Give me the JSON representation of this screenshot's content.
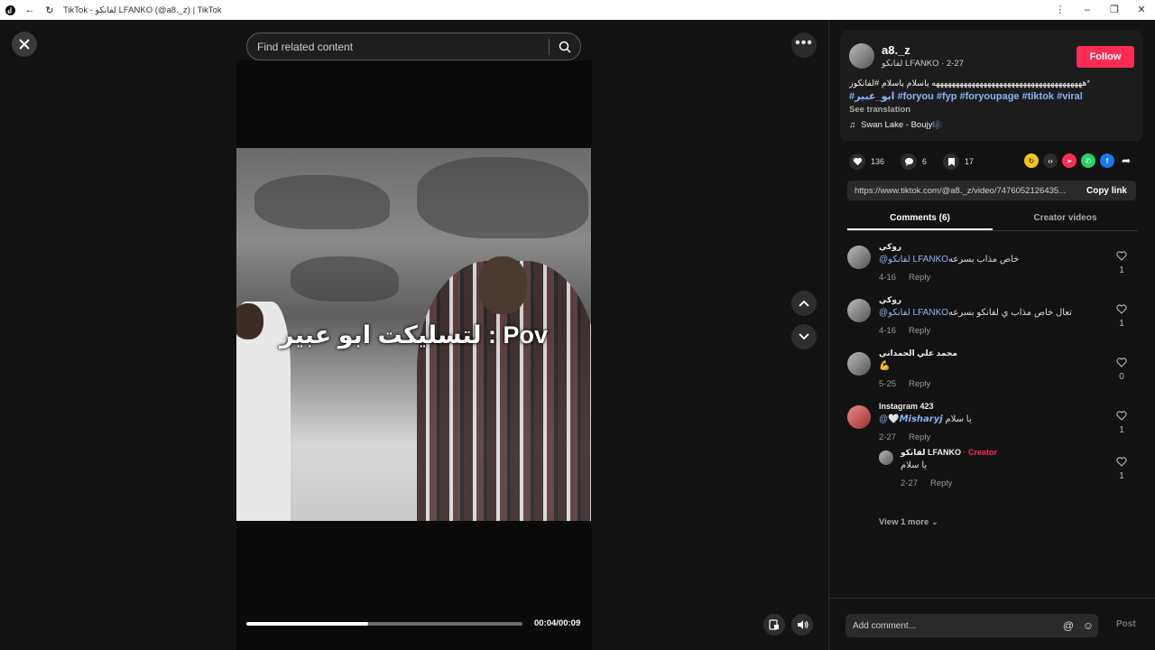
{
  "window": {
    "title": "TikTok - لفانكو LFANKO (@a8._z) | TikTok",
    "controls": [
      "⋮",
      "–",
      "❐",
      "✕"
    ]
  },
  "player": {
    "search_placeholder": "Find related content",
    "caption": "لتسليكت ابو عبير : Pov",
    "progress": 0.44,
    "timecode": "00:04/00:09"
  },
  "video_info": {
    "username": "a8._z",
    "subline": "لفانكو LFANKO · 2-27",
    "follow_label": "Follow",
    "description": "*ههههههههههههههههههههههههههههههههههههههه ياسلام ياسلام #لفانكوز",
    "hashtags": "#ابو_عبير #foryou #fyp #foryoupage #tiktok #viral",
    "see_translation": "See translation",
    "music": "Swan Lake - Boujy🎼"
  },
  "stats": {
    "likes": "136",
    "comments": "6",
    "saves": "17"
  },
  "share": {
    "url": "https://www.tiktok.com/@a8._z/video/7476052126435...",
    "copy_label": "Copy link"
  },
  "tabs": {
    "comments": "Comments (6)",
    "creator_videos": "Creator videos"
  },
  "comments": [
    {
      "name": "روكي",
      "mention": "@لفانكو LFANKO",
      "text": "خاص مذاب بسرعه",
      "date": "4-16",
      "reply": "Reply",
      "likes": "1"
    },
    {
      "name": "روكي",
      "mention": "@لفانكو LFANKO",
      "text": "تعال خاص مذاب ي لفانكو بسرعه",
      "date": "4-16",
      "reply": "Reply",
      "likes": "1"
    },
    {
      "name": "محمد علي الحمداني",
      "mention": "",
      "text": "💪",
      "date": "5-25",
      "reply": "Reply",
      "likes": "0"
    },
    {
      "name": "Instagram 423",
      "mention": "@🤍𝙈𝙞𝙨𝙝𝙖𝙧𝙮𝙟",
      "text": "يا سلام",
      "date": "2-27",
      "reply": "Reply",
      "likes": "1"
    }
  ],
  "reply": {
    "name": "لفانكو LFANKO",
    "creator_tag": "· Creator",
    "text": "يا سلام",
    "date": "2-27",
    "reply": "Reply",
    "likes": "1"
  },
  "view_more": "View 1 more",
  "composer": {
    "placeholder": "Add comment...",
    "post_label": "Post"
  }
}
